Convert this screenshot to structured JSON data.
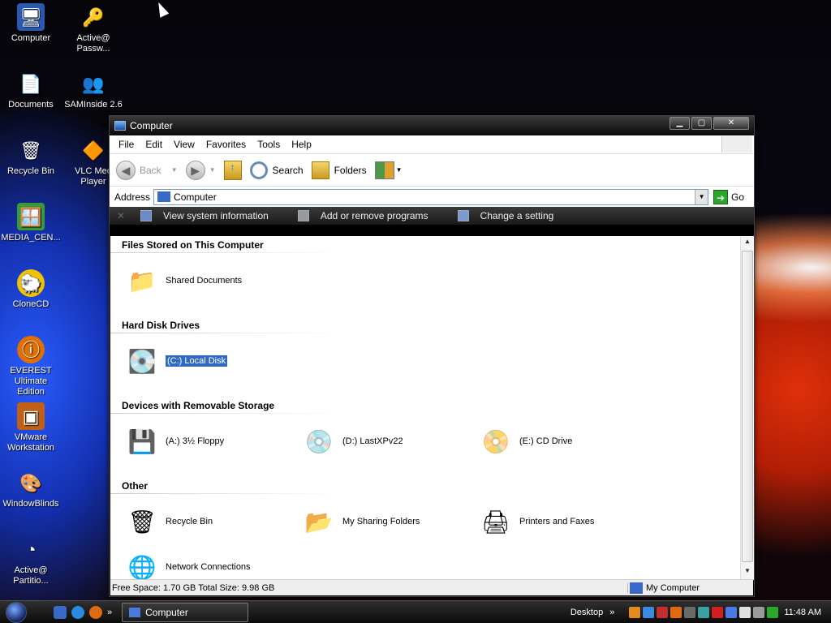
{
  "desktop": {
    "icons": [
      {
        "label": "Computer",
        "glyph": "🖥"
      },
      {
        "label": "Active@ Passw...",
        "glyph": "🔑"
      },
      {
        "label": "Documents",
        "glyph": "📄"
      },
      {
        "label": "SAMInside 2.6",
        "glyph": "👥"
      },
      {
        "label": "Recycle Bin",
        "glyph": "🗑"
      },
      {
        "label": "VLC Med Player",
        "glyph": "🔶"
      },
      {
        "label": "MEDIA_CEN...",
        "glyph": "🪟"
      },
      {
        "label": "CloneCD",
        "glyph": "🐑"
      },
      {
        "label": "EVEREST Ultimate Edition",
        "glyph": "ⓘ"
      },
      {
        "label": "VMware Workstation",
        "glyph": "▣"
      },
      {
        "label": "WindowBlinds",
        "glyph": "🎨"
      },
      {
        "label": "Active@ Partitio...",
        "glyph": "◔"
      }
    ]
  },
  "window": {
    "title": "Computer",
    "controls": {
      "minimize": "▁",
      "maximize": "▢",
      "close": "✕"
    },
    "menu": [
      "File",
      "Edit",
      "View",
      "Favorites",
      "Tools",
      "Help"
    ],
    "toolbar": {
      "back": "Back",
      "search": "Search",
      "folders": "Folders"
    },
    "address": {
      "label": "Address",
      "value": "Computer",
      "go": "Go"
    },
    "tasks": [
      "View system information",
      "Add or remove programs",
      "Change a setting"
    ],
    "groups": [
      {
        "title": "Files Stored on This Computer",
        "items": [
          {
            "label": "Shared Documents",
            "glyph": "📁"
          }
        ]
      },
      {
        "title": "Hard Disk Drives",
        "items": [
          {
            "label": "(C:) Local Disk",
            "glyph": "💽"
          }
        ]
      },
      {
        "title": "Devices with Removable Storage",
        "items": [
          {
            "label": "(A:) 3½ Floppy",
            "glyph": "💾"
          },
          {
            "label": "(D:) LastXPv22",
            "glyph": "💿"
          },
          {
            "label": "(E:) CD Drive",
            "glyph": "📀"
          }
        ]
      },
      {
        "title": "Other",
        "items": [
          {
            "label": "Recycle Bin",
            "glyph": "🗑"
          },
          {
            "label": "My Sharing Folders",
            "glyph": "📂"
          },
          {
            "label": "Printers and Faxes",
            "glyph": "🖨"
          },
          {
            "label": "Network Connections",
            "glyph": "🌐"
          }
        ]
      }
    ],
    "status": {
      "left": "Free Space: 1.70 GB Total Size: 9.98 GB",
      "right": "My Computer"
    }
  },
  "taskbar": {
    "task": "Computer",
    "toolbar": "Desktop",
    "chevron": "»",
    "clock": "11:48 AM"
  }
}
